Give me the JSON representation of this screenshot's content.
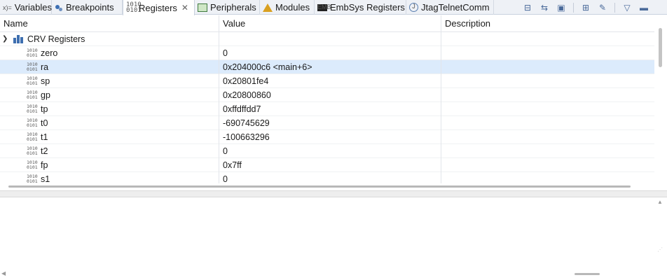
{
  "tabs": [
    {
      "label": "Variables",
      "icon": "variables-icon"
    },
    {
      "label": "Breakpoints",
      "icon": "breakpoints-icon"
    },
    {
      "label": "Registers",
      "icon": "registers-icon",
      "active": true,
      "closable": true
    },
    {
      "label": "Peripherals",
      "icon": "peripherals-icon"
    },
    {
      "label": "Modules",
      "icon": "modules-icon"
    },
    {
      "label": "EmbSys Registers",
      "icon": "embsys-icon"
    },
    {
      "label": "JtagTelnetComm",
      "icon": "jtag-icon"
    }
  ],
  "columns": {
    "name": "Name",
    "value": "Value",
    "description": "Description"
  },
  "group": {
    "name": "CRV Registers",
    "expanded": true
  },
  "registers": [
    {
      "name": "zero",
      "value": "0",
      "description": ""
    },
    {
      "name": "ra",
      "value": "0x204000c6 <main+6>",
      "description": "",
      "selected": true
    },
    {
      "name": "sp",
      "value": "0x20801fe4",
      "description": ""
    },
    {
      "name": "gp",
      "value": "0x20800860",
      "description": ""
    },
    {
      "name": "tp",
      "value": "0xffdffdd7",
      "description": ""
    },
    {
      "name": "t0",
      "value": "-690745629",
      "description": ""
    },
    {
      "name": "t1",
      "value": "-100663296",
      "description": ""
    },
    {
      "name": "t2",
      "value": "0",
      "description": ""
    },
    {
      "name": "fp",
      "value": "0x7ff",
      "description": ""
    },
    {
      "name": "s1",
      "value": "0",
      "description": ""
    }
  ],
  "colors": {
    "selection": "#dcebfc",
    "tabbar": "#eef1f6",
    "group_icon": "#3e6fb0"
  }
}
